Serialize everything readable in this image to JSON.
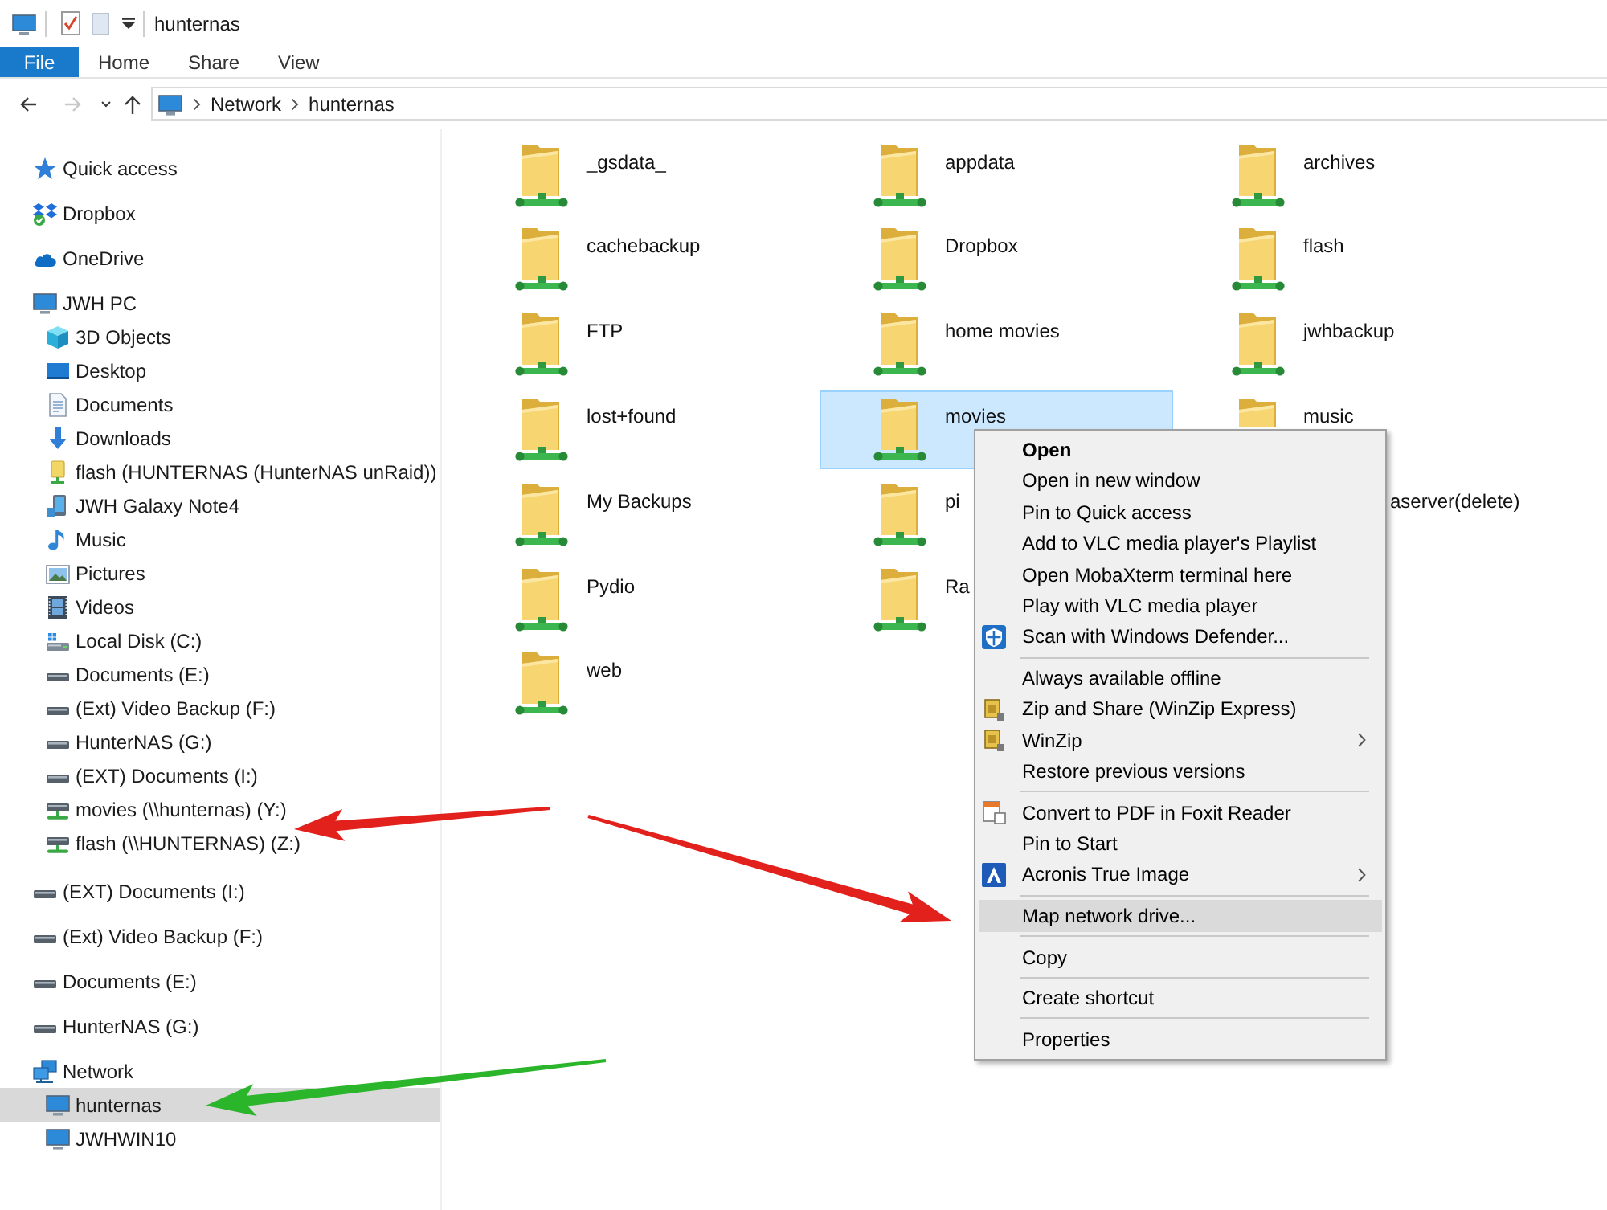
{
  "window": {
    "title": "hunternas"
  },
  "ribbon": {
    "tabs": [
      {
        "label": "File",
        "kind": "file",
        "selected": false
      },
      {
        "label": "Home",
        "kind": "tab",
        "selected": false
      },
      {
        "label": "Share",
        "kind": "tab",
        "selected": false
      },
      {
        "label": "View",
        "kind": "tab",
        "selected": false
      }
    ]
  },
  "navigation": {
    "buttons": [
      {
        "kind": "back",
        "disabled": false
      },
      {
        "kind": "forward",
        "disabled": true
      },
      {
        "kind": "recent",
        "disabled": false
      },
      {
        "kind": "up",
        "disabled": false
      }
    ],
    "breadcrumb": [
      "Network",
      "hunternas"
    ]
  },
  "sidebar": {
    "items": [
      {
        "label": "Quick access",
        "kind": "star",
        "selected": false
      },
      {
        "label": "Dropbox",
        "kind": "dropbox",
        "selected": false
      },
      {
        "label": "OneDrive",
        "kind": "cloud",
        "selected": false
      },
      {
        "label": "JWH PC",
        "kind": "computer",
        "selected": false,
        "children": [
          {
            "label": "3D Objects",
            "kind": "cube",
            "selected": false
          },
          {
            "label": "Desktop",
            "kind": "desktop",
            "selected": false
          },
          {
            "label": "Documents",
            "kind": "documents",
            "selected": false
          },
          {
            "label": "Downloads",
            "kind": "downloads",
            "selected": false
          },
          {
            "label": "flash (HUNTERNAS (HunterNAS unRaid))",
            "kind": "share",
            "selected": false
          },
          {
            "label": "JWH Galaxy Note4",
            "kind": "phone",
            "selected": false
          },
          {
            "label": "Music",
            "kind": "music",
            "selected": false
          },
          {
            "label": "Pictures",
            "kind": "pictures",
            "selected": false
          },
          {
            "label": "Videos",
            "kind": "videos",
            "selected": false
          },
          {
            "label": "Local Disk (C:)",
            "kind": "system_disk",
            "selected": false
          },
          {
            "label": "Documents (E:)",
            "kind": "drive",
            "selected": false
          },
          {
            "label": "(Ext) Video Backup (F:)",
            "kind": "drive",
            "selected": false
          },
          {
            "label": "HunterNAS (G:)",
            "kind": "drive",
            "selected": false
          },
          {
            "label": "(EXT) Documents (I:)",
            "kind": "drive",
            "selected": false
          },
          {
            "label": "movies (\\\\hunternas) (Y:)",
            "kind": "network_drive",
            "selected": false
          },
          {
            "label": "flash (\\\\HUNTERNAS) (Z:)",
            "kind": "network_drive",
            "selected": false
          }
        ]
      },
      {
        "label": "(EXT) Documents (I:)",
        "kind": "drive",
        "selected": false
      },
      {
        "label": "(Ext) Video Backup (F:)",
        "kind": "drive",
        "selected": false
      },
      {
        "label": "Documents (E:)",
        "kind": "drive",
        "selected": false
      },
      {
        "label": "HunterNAS (G:)",
        "kind": "drive",
        "selected": false
      },
      {
        "label": "Network",
        "kind": "network",
        "selected": false,
        "children": [
          {
            "label": "hunternas",
            "kind": "computer",
            "selected": true
          },
          {
            "label": "JWHWIN10",
            "kind": "computer",
            "selected": false
          }
        ]
      }
    ]
  },
  "folders": {
    "rows": [
      [
        {
          "name": "_gsdata_",
          "kind": "folder",
          "selected": false
        },
        {
          "name": "appdata",
          "kind": "folder",
          "selected": false
        },
        {
          "name": "archives",
          "kind": "folder",
          "selected": false
        }
      ],
      [
        {
          "name": "cachebackup",
          "kind": "folder",
          "selected": false
        },
        {
          "name": "Dropbox",
          "kind": "folder",
          "selected": false
        },
        {
          "name": "flash",
          "kind": "folder",
          "selected": false
        }
      ],
      [
        {
          "name": "FTP",
          "kind": "folder",
          "selected": false
        },
        {
          "name": "home movies",
          "kind": "folder",
          "selected": false
        },
        {
          "name": "jwhbackup",
          "kind": "folder",
          "selected": false
        }
      ],
      [
        {
          "name": "lost+found",
          "kind": "folder",
          "selected": false
        },
        {
          "name": "movies",
          "kind": "folder",
          "selected": true
        },
        {
          "name": "music",
          "kind": "folder_top",
          "selected": false
        }
      ],
      [
        {
          "name": "My Backups",
          "kind": "folder",
          "selected": false
        },
        {
          "name": "pi",
          "kind": "folder",
          "selected": false
        },
        {
          "name": "aserver(delete)",
          "kind": "label",
          "selected": false
        }
      ],
      [
        {
          "name": "Pydio",
          "kind": "folder",
          "selected": false
        },
        {
          "name": "Ra",
          "kind": "folder",
          "selected": false
        }
      ],
      [
        {
          "name": "web",
          "kind": "folder",
          "selected": false
        }
      ]
    ]
  },
  "context_menu": {
    "groups": [
      [
        {
          "label": "Open",
          "kind": "plain",
          "default": true,
          "highlighted": false,
          "submenu": false
        },
        {
          "label": "Open in new window",
          "kind": "plain",
          "default": false,
          "highlighted": false,
          "submenu": false
        },
        {
          "label": "Pin to Quick access",
          "kind": "plain",
          "default": false,
          "highlighted": false,
          "submenu": false
        },
        {
          "label": "Add to VLC media player's Playlist",
          "kind": "plain",
          "default": false,
          "highlighted": false,
          "submenu": false
        },
        {
          "label": "Open MobaXterm terminal here",
          "kind": "plain",
          "default": false,
          "highlighted": false,
          "submenu": false
        },
        {
          "label": "Play with VLC media player",
          "kind": "plain",
          "default": false,
          "highlighted": false,
          "submenu": false
        },
        {
          "label": "Scan with Windows Defender...",
          "kind": "shield",
          "default": false,
          "highlighted": false,
          "submenu": false
        }
      ],
      [
        {
          "label": "Always available offline",
          "kind": "plain",
          "default": false,
          "highlighted": false,
          "submenu": false
        },
        {
          "label": "Zip and Share (WinZip Express)",
          "kind": "zip",
          "default": false,
          "highlighted": false,
          "submenu": false
        },
        {
          "label": "WinZip",
          "kind": "zip",
          "default": false,
          "highlighted": false,
          "submenu": true
        },
        {
          "label": "Restore previous versions",
          "kind": "plain",
          "default": false,
          "highlighted": false,
          "submenu": false
        }
      ],
      [
        {
          "label": "Convert to PDF in Foxit Reader",
          "kind": "pdf",
          "default": false,
          "highlighted": false,
          "submenu": false
        },
        {
          "label": "Pin to Start",
          "kind": "plain",
          "default": false,
          "highlighted": false,
          "submenu": false
        },
        {
          "label": "Acronis True Image",
          "kind": "acronis",
          "default": false,
          "highlighted": false,
          "submenu": true
        }
      ],
      [
        {
          "label": "Map network drive...",
          "kind": "plain",
          "default": false,
          "highlighted": true,
          "submenu": false
        }
      ],
      [
        {
          "label": "Copy",
          "kind": "plain",
          "default": false,
          "highlighted": false,
          "submenu": false
        }
      ],
      [
        {
          "label": "Create shortcut",
          "kind": "plain",
          "default": false,
          "highlighted": false,
          "submenu": false
        }
      ],
      [
        {
          "label": "Properties",
          "kind": "plain",
          "default": false,
          "highlighted": false,
          "submenu": false
        }
      ]
    ]
  },
  "annotation_arrows": [
    {
      "color": "#e3211c"
    },
    {
      "color": "#e3211c"
    },
    {
      "color": "#2bb52b"
    }
  ]
}
